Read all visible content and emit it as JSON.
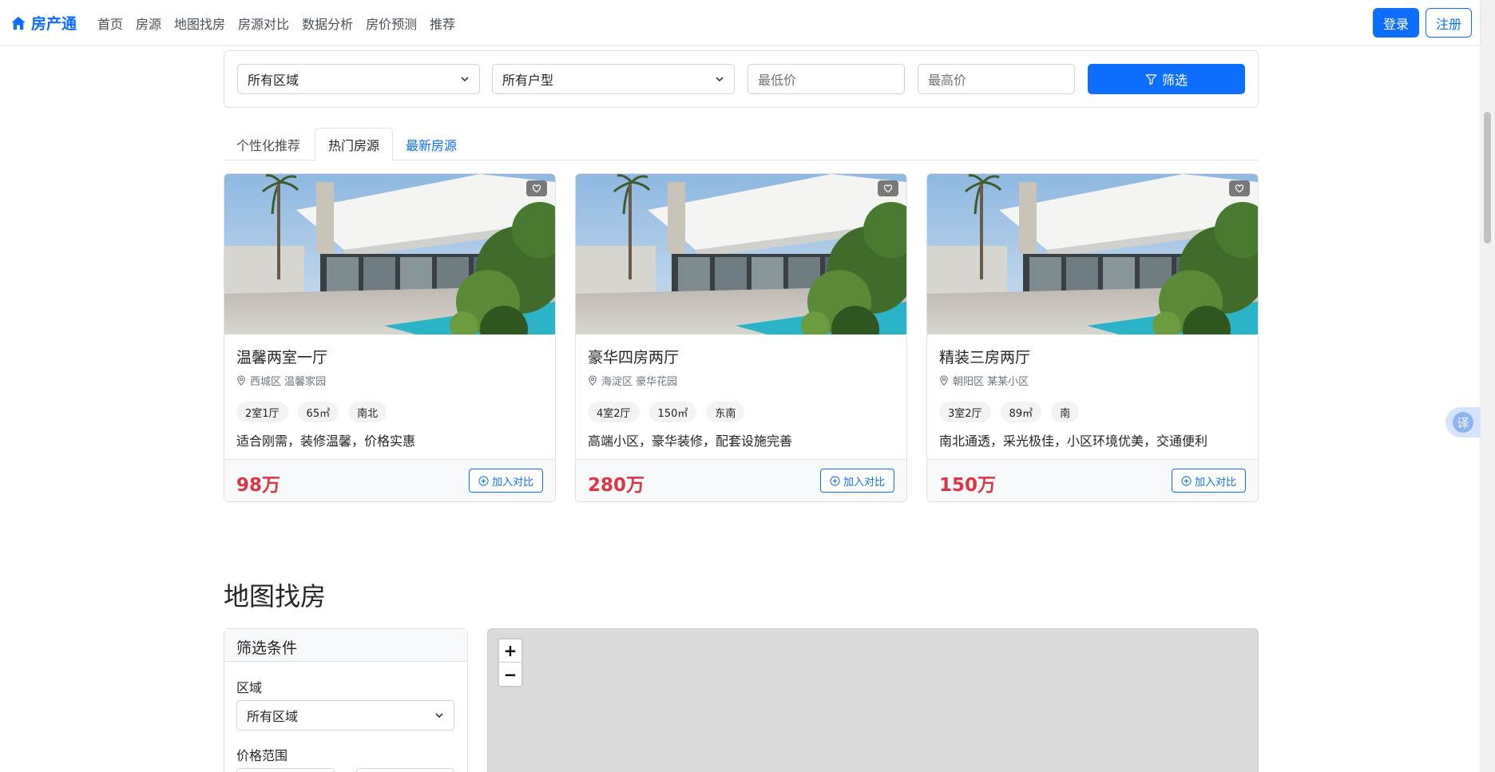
{
  "navbar": {
    "brand": "房产通",
    "links": [
      "首页",
      "房源",
      "地图找房",
      "房源对比",
      "数据分析",
      "房价预测",
      "推荐"
    ],
    "login": "登录",
    "register": "注册"
  },
  "search": {
    "region_select": "所有区域",
    "layout_select": "所有户型",
    "min_price_placeholder": "最低价",
    "max_price_placeholder": "最高价",
    "filter_button": "筛选"
  },
  "tabs": [
    "个性化推荐",
    "热门房源",
    "最新房源"
  ],
  "active_tab": "热门房源",
  "listings": [
    {
      "title": "温馨两室一厅",
      "location": "西城区 温馨家园",
      "tags": [
        "2室1厅",
        "65㎡",
        "南北"
      ],
      "description": "适合刚需，装修温馨，价格实惠",
      "price": "98万",
      "compare_label": "加入对比"
    },
    {
      "title": "豪华四房两厅",
      "location": "海淀区 豪华花园",
      "tags": [
        "4室2厅",
        "150㎡",
        "东南"
      ],
      "description": "高端小区，豪华装修，配套设施完善",
      "price": "280万",
      "compare_label": "加入对比"
    },
    {
      "title": "精装三房两厅",
      "location": "朝阳区 某某小区",
      "tags": [
        "3室2厅",
        "89㎡",
        "南"
      ],
      "description": "南北通透，采光极佳，小区环境优美，交通便利",
      "price": "150万",
      "compare_label": "加入对比"
    }
  ],
  "translate_label": "译",
  "map_section": {
    "title": "地图找房",
    "panel_title": "筛选条件",
    "region_label": "区域",
    "region_select": "所有区域",
    "price_label": "价格范围",
    "zoom_in": "+",
    "zoom_out": "−"
  },
  "colors": {
    "primary": "#0d6efd",
    "price": "#dc3545",
    "muted": "#6c757d"
  }
}
